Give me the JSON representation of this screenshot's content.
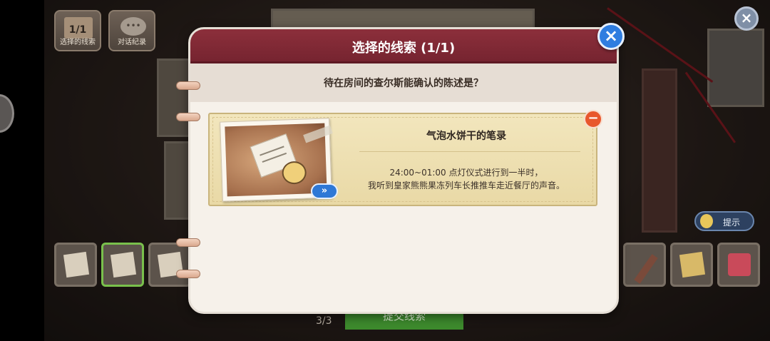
{
  "topbar": {
    "clue_counter": "1/1",
    "selected_clues_label": "选择的线索",
    "dialog_log_label": "对话纪录"
  },
  "hint_label": "提示",
  "bottom": {
    "page_counter": "3/3",
    "submit_label": "提交线索"
  },
  "modal": {
    "title": "选择的线索 (1/1)",
    "question": "待在房间的查尔斯能确认的陈述是？",
    "clue": {
      "title": "气泡水饼干的笔录",
      "line1": "24:00~01:00 点灯仪式进行到一半时，",
      "line2": "我听到皇家熊熊果冻列车长推推车走近餐厅的声音。"
    },
    "expand_symbol": "»",
    "remove_symbol": "−",
    "close_symbol": "×"
  },
  "corner_close_symbol": "×",
  "colors": {
    "header": "#7f2a35",
    "close_button": "#2f7de0",
    "remove_button": "#e8572c",
    "submit_button": "#3d8a2d"
  }
}
